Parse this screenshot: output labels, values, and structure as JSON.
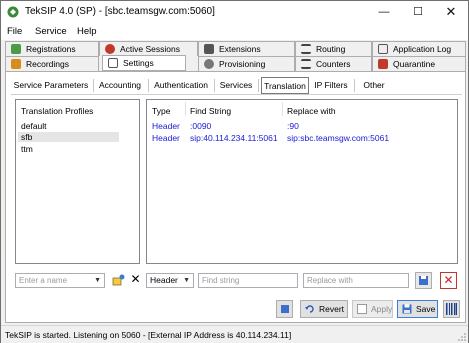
{
  "window": {
    "title": "TekSIP 4.0 (SP) - [sbc.teamsgw.com:5060]"
  },
  "menu": [
    "File",
    "Service",
    "Help"
  ],
  "top_tabs_row1": [
    "Registrations",
    "Active Sessions",
    "Extensions",
    "Routing",
    "Application Log"
  ],
  "top_tabs_row2": [
    "Recordings",
    "Settings",
    "Provisioning",
    "Counters",
    "Quarantine"
  ],
  "active_top_tab": "Settings",
  "sub_tabs": [
    "Service Parameters",
    "Accounting",
    "Authentication",
    "Services",
    "Translation",
    "IP Filters",
    "Other"
  ],
  "active_sub_tab": "Translation",
  "profiles": {
    "header": "Translation Profiles",
    "items": [
      "default",
      "sfb",
      "ttm"
    ],
    "selected": "sfb"
  },
  "rules": {
    "columns": [
      "Type",
      "Find String",
      "Replace with"
    ],
    "rows": [
      {
        "type": "Header",
        "find": ":0090",
        "replace": ":90"
      },
      {
        "type": "Header",
        "find": "sip:40.114.234.11:5061",
        "replace": "sip:sbc.teamsgw.com:5061"
      }
    ]
  },
  "editor": {
    "name_placeholder": "Enter a name",
    "type_value": "Header",
    "find_placeholder": "Find string",
    "replace_placeholder": "Replace with"
  },
  "buttons": {
    "revert": "Revert",
    "apply": "Apply",
    "save": "Save"
  },
  "status": "TekSIP is started. Listening on 5060 - [External IP Address is 40.114.234.11]"
}
